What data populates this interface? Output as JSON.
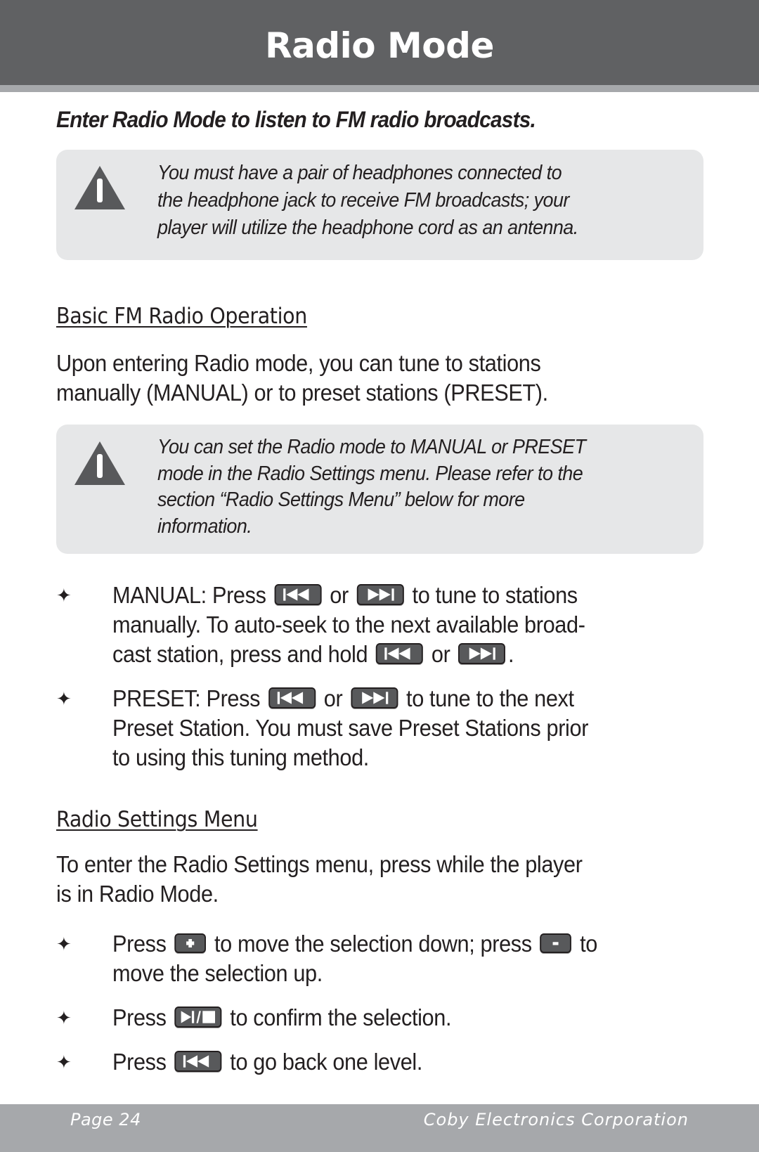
{
  "header": {
    "title": "Radio Mode"
  },
  "intro": "Enter Radio Mode to listen to FM radio broadcasts.",
  "notes": [
    {
      "icon": "warning-icon",
      "text": "You must have a pair of headphones connected to\nthe headphone jack to receive FM broadcasts; your\nplayer will utilize the headphone cord as an antenna."
    },
    {
      "icon": "warning-icon",
      "text": "You can set the Radio mode to MANUAL or PRESET\nmode in the Radio Settings menu. Please refer to the\nsection “Radio Settings Menu”  below for more\ninformation."
    }
  ],
  "sections": {
    "basic": {
      "heading": "Basic FM Radio Operation",
      "paragraph": "Upon entering Radio mode, you can tune to stations\nmanually (MANUAL) or to preset stations (PRESET).",
      "bullets": [
        {
          "parts": [
            "MANUAL: Press ",
            " or ",
            " to tune to stations manually. To auto-seek to the next available broad-cast station, press and hold ",
            " or ",
            "."
          ],
          "line1": [
            "MANUAL: Press ",
            " or ",
            " to tune to stations"
          ],
          "line2": "manually. To auto-seek to the next available broad-",
          "line3": [
            "cast station, press and hold ",
            " or ",
            "."
          ]
        },
        {
          "line1": [
            "PRESET: Press ",
            " or ",
            " to tune to the next"
          ],
          "line2": "Preset Station. You must save Preset Stations prior",
          "line3": "to using this tuning method."
        }
      ]
    },
    "settings": {
      "heading": "Radio Settings Menu",
      "paragraph": "To enter the Radio Settings menu, press while the player\nis in Radio Mode.",
      "bullets": [
        {
          "line1": [
            "Press ",
            " to move the selection down; press ",
            " to"
          ],
          "line2": "move the selection up."
        },
        {
          "line1": [
            "Press ",
            " to confirm the selection."
          ]
        },
        {
          "line1": [
            "Press ",
            " to go back one level."
          ]
        }
      ]
    }
  },
  "buttons": {
    "prev": "previous-track-button-icon",
    "next": "next-track-button-icon",
    "plus": "+",
    "minus": "–",
    "play_stop": "play-stop-button-icon"
  },
  "bullet_glyph": "✦",
  "footer": {
    "page": "Page 24",
    "company": "Coby Electronics Corporation"
  }
}
